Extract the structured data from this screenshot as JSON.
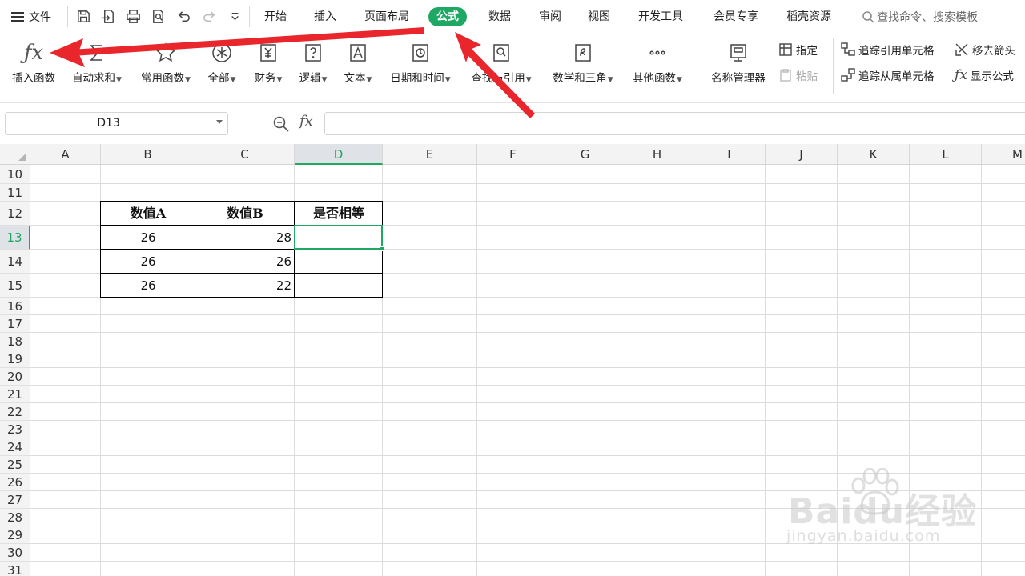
{
  "menubar": {
    "file_label": "文件",
    "tabs": [
      {
        "label": "开始"
      },
      {
        "label": "插入"
      },
      {
        "label": "页面布局"
      },
      {
        "label": "公式"
      },
      {
        "label": "数据"
      },
      {
        "label": "审阅"
      },
      {
        "label": "视图"
      },
      {
        "label": "开发工具"
      },
      {
        "label": "会员专享"
      },
      {
        "label": "稻壳资源"
      }
    ],
    "active_tab": "公式",
    "search_placeholder": "查找命令、搜索模板"
  },
  "ribbon": {
    "insert_function": "插入函数",
    "autosum": "自动求和",
    "common": "常用函数",
    "all": "全部",
    "finance": "财务",
    "logic": "逻辑",
    "text": "文本",
    "datetime": "日期和时间",
    "lookup": "查找与引用",
    "math": "数学和三角",
    "other": "其他函数",
    "name_manager": "名称管理器",
    "specify": "指定",
    "paste": "粘贴",
    "trace_precedents": "追踪引用单元格",
    "trace_dependents": "追踪从属单元格",
    "remove_arrows": "移去箭头",
    "show_formulas": "显示公式"
  },
  "formula_bar": {
    "name_box": "D13",
    "fx_label": "fx",
    "formula": ""
  },
  "sheet": {
    "columns": [
      "A",
      "B",
      "C",
      "D",
      "E",
      "F",
      "G",
      "H",
      "I",
      "J",
      "K",
      "L",
      "M"
    ],
    "rows": [
      "10",
      "11",
      "12",
      "13",
      "14",
      "15",
      "16",
      "17",
      "18",
      "19",
      "20",
      "21",
      "22",
      "23",
      "24",
      "25",
      "26",
      "27",
      "28",
      "29",
      "30",
      "31"
    ],
    "selected_column": "D",
    "selected_row": "13",
    "table": {
      "headers": [
        "数值A",
        "数值B",
        "是否相等"
      ],
      "rows": [
        [
          "26",
          "28",
          ""
        ],
        [
          "26",
          "26",
          ""
        ],
        [
          "26",
          "22",
          ""
        ]
      ]
    }
  },
  "watermark": {
    "brand": "Baidu经验",
    "site": "jingyan.baidu.com"
  },
  "colors": {
    "accent": "#1fa764",
    "arrow": "#e8262b",
    "grid": "#dcdcdc"
  }
}
